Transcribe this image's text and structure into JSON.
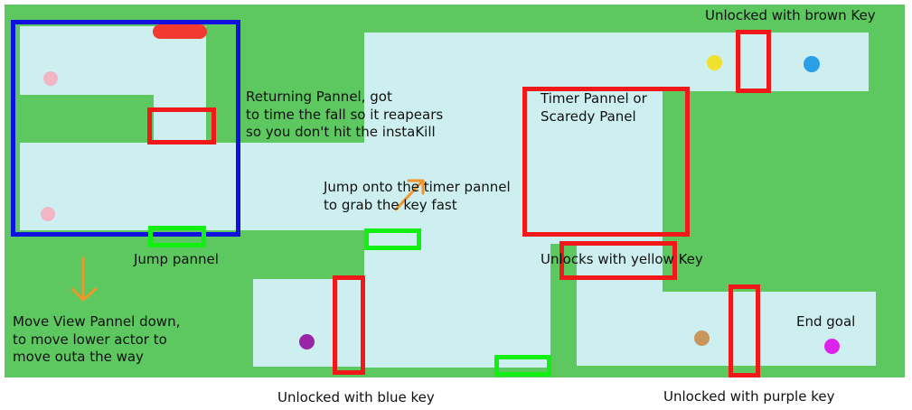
{
  "colors": {
    "ground": "#5cc85f",
    "room": "#cdeff0",
    "locked_door": "#f01818",
    "view_panel": "#1010e0",
    "jump_pad": "#12f012",
    "hazard": "#f23a30",
    "arrow": "#f0962a"
  },
  "annotations": {
    "returning_panel": "Returning Pannel, got\nto time the fall so it reapears\nso you don't hit the instaKill",
    "timer_panel": "Timer Pannel or\nScaredy Panel",
    "jump_timer": "Jump onto the timer pannel\nto grab the key fast",
    "jump_pannel": "Jump pannel",
    "move_view": "Move View Pannel down,\nto move lower actor to\nmove outa the way",
    "yellow_key": "Unlocks with yellow Key",
    "brown_key": "Unlocked with brown Key",
    "blue_key": "Unlocked with blue key",
    "purple_key": "Unlocked with purple key",
    "end_goal": "End goal"
  },
  "keys": [
    {
      "name": "yellow-key",
      "color": "#f0e030"
    },
    {
      "name": "blue-key",
      "color": "#2b9ee8"
    },
    {
      "name": "purple-key",
      "color": "#9a24a8"
    },
    {
      "name": "brown-key",
      "color": "#c8955c"
    }
  ],
  "actors": [
    {
      "name": "pink-actor-upper",
      "color": "#f2b5c4"
    },
    {
      "name": "pink-actor-lower",
      "color": "#f2b5c4"
    }
  ],
  "goal": {
    "color": "#dd22ee"
  }
}
